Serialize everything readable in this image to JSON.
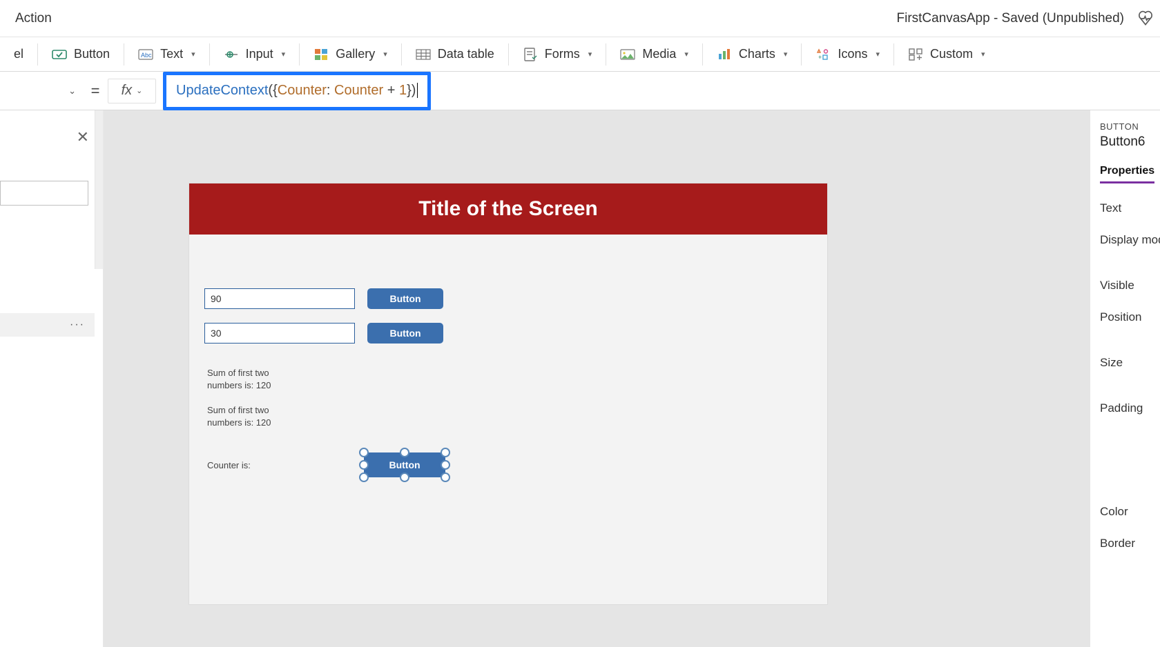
{
  "menu": {
    "action_label": "Action",
    "status_text": "FirstCanvasApp - Saved (Unpublished)"
  },
  "ribbon": {
    "el_stub": "el",
    "button": "Button",
    "text": "Text",
    "input": "Input",
    "gallery": "Gallery",
    "data_table": "Data table",
    "forms": "Forms",
    "media": "Media",
    "charts": "Charts",
    "icons": "Icons",
    "custom": "Custom"
  },
  "formula": {
    "fx": "fx",
    "fn": "UpdateContext",
    "open": "({",
    "ident1": "Counter",
    "colon": ": ",
    "ident2": "Counter",
    "plus": " + ",
    "num": "1",
    "close": "})"
  },
  "left": {
    "ellipsis": "···"
  },
  "canvas": {
    "header_title": "Title of the Screen",
    "input1_value": "90",
    "input2_value": "30",
    "btn1_label": "Button",
    "btn2_label": "Button",
    "sum_label_1": "Sum of first two\nnumbers is: 120",
    "sum_label_2": "Sum of first two\nnumbers is: 120",
    "counter_label": "Counter is:",
    "selected_btn_label": "Button"
  },
  "rpane": {
    "category": "BUTTON",
    "control_name": "Button6",
    "tab": "Properties",
    "props": {
      "text": "Text",
      "display_mode": "Display mod",
      "visible": "Visible",
      "position": "Position",
      "size": "Size",
      "padding": "Padding",
      "color": "Color",
      "border": "Border"
    }
  }
}
